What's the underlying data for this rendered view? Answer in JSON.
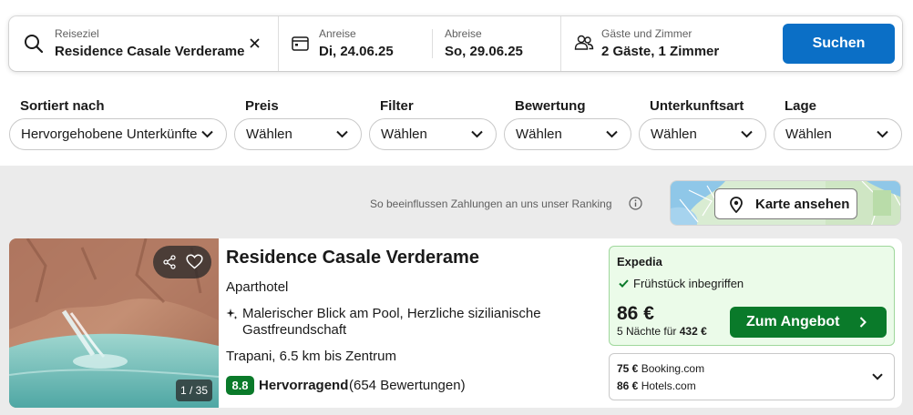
{
  "search": {
    "destination_label": "Reiseziel",
    "destination_value": "Residence Casale Verderame",
    "checkin_label": "Anreise",
    "checkin_value": "Di, 24.06.25",
    "checkout_label": "Abreise",
    "checkout_value": "So, 29.06.25",
    "guests_label": "Gäste und Zimmer",
    "guests_value": "2 Gäste, 1 Zimmer",
    "search_button": "Suchen"
  },
  "filters": [
    {
      "label": "Sortiert nach",
      "value": "Hervorgehobene Unterkünfte"
    },
    {
      "label": "Preis",
      "value": "Wählen"
    },
    {
      "label": "Filter",
      "value": "Wählen"
    },
    {
      "label": "Bewertung",
      "value": "Wählen"
    },
    {
      "label": "Unterkunftsart",
      "value": "Wählen"
    },
    {
      "label": "Lage",
      "value": "Wählen"
    }
  ],
  "ranking_note": "So beeinflussen Zahlungen an uns unser Ranking",
  "map_button": "Karte ansehen",
  "hotel": {
    "name": "Residence Casale Verderame",
    "type": "Aparthotel",
    "highlight": "Malerischer Blick am Pool, Herzliche sizilianische Gastfreundschaft",
    "location": "Trapani, 6.5 km bis Zentrum",
    "rating_score": "8.8",
    "rating_word": "Hervorragend",
    "rating_count": "(654 Bewertungen)",
    "photo_counter": "1 / 35"
  },
  "deal": {
    "provider": "Expedia",
    "perk": "Frühstück inbegriffen",
    "price": "86 €",
    "nights_text": "5 Nächte für",
    "nights_total": "432 €",
    "button": "Zum Angebot"
  },
  "other_prices": [
    {
      "price": "75 €",
      "provider": "Booking.com"
    },
    {
      "price": "86 €",
      "provider": "Hotels.com"
    }
  ],
  "colors": {
    "primary_blue": "#0b6fc6",
    "deal_green": "#0a7a2a",
    "deal_bg": "#ebfbe9",
    "results_bg": "#ebebeb"
  },
  "icons": [
    "search-icon",
    "clear-icon",
    "calendar-icon",
    "guests-icon",
    "chevron-down-icon",
    "info-icon",
    "map-pin-icon",
    "share-icon",
    "heart-icon",
    "sparkle-icon",
    "check-icon",
    "chevron-right-icon"
  ]
}
